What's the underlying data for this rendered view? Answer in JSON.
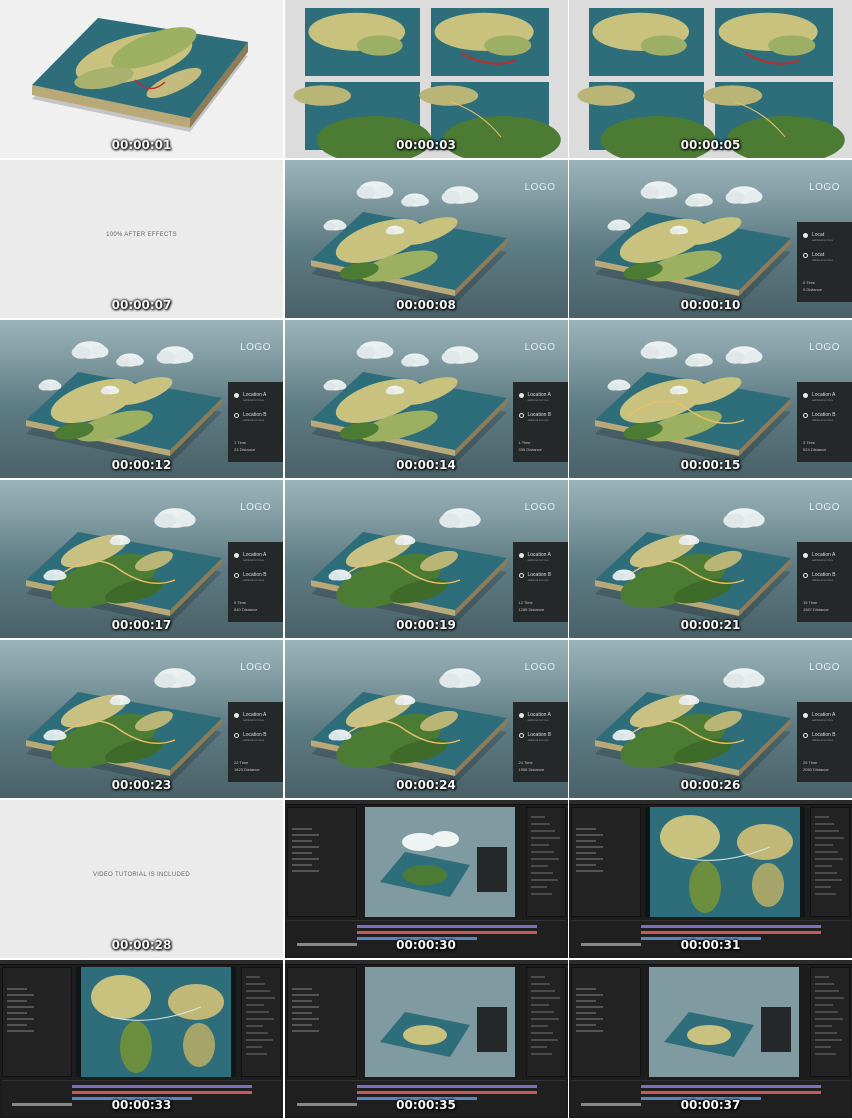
{
  "frames": [
    {
      "time": "00:00:01",
      "kind": "intro-3d"
    },
    {
      "time": "00:00:03",
      "kind": "tiles"
    },
    {
      "time": "00:00:05",
      "kind": "tiles"
    },
    {
      "time": "00:00:07",
      "kind": "plain",
      "caption": "100% AFTER EFFECTS"
    },
    {
      "time": "00:00:08",
      "kind": "map",
      "panel": null
    },
    {
      "time": "00:00:10",
      "kind": "map",
      "panel": {
        "loc_a": "Locat",
        "loc_b": "Locat",
        "time": "Time",
        "distance": "Distance",
        "time_val": "0",
        "distance_val": "0"
      }
    },
    {
      "time": "00:00:12",
      "kind": "map",
      "panel": {
        "loc_a": "Location A",
        "loc_b": "Location B",
        "time": "Time",
        "distance": "Distance",
        "time_val": "1",
        "distance_val": "23"
      }
    },
    {
      "time": "00:00:14",
      "kind": "map",
      "panel": {
        "loc_a": "Location A",
        "loc_b": "Location B",
        "time": "Time",
        "distance": "Distance",
        "time_val": "1",
        "distance_val": "336"
      }
    },
    {
      "time": "00:00:15",
      "kind": "map",
      "panel": {
        "loc_a": "Location A",
        "loc_b": "Location B",
        "time": "Time",
        "distance": "Distance",
        "time_val": "3",
        "distance_val": "524"
      }
    },
    {
      "time": "00:00:17",
      "kind": "map",
      "panel": {
        "loc_a": "Location A",
        "loc_b": "Location B",
        "time": "Time",
        "distance": "Distance",
        "time_val": "9",
        "distance_val": "840"
      }
    },
    {
      "time": "00:00:19",
      "kind": "map",
      "panel": {
        "loc_a": "Location A",
        "loc_b": "Location B",
        "time": "Time",
        "distance": "Distance",
        "time_val": "12",
        "distance_val": "1285"
      }
    },
    {
      "time": "00:00:21",
      "kind": "map",
      "panel": {
        "loc_a": "Location A",
        "loc_b": "Location B",
        "time": "Time",
        "distance": "Distance",
        "time_val": "15",
        "distance_val": "1567"
      }
    },
    {
      "time": "00:00:23",
      "kind": "map",
      "panel": {
        "loc_a": "Location A",
        "loc_b": "Location B",
        "time": "Time",
        "distance": "Distance",
        "time_val": "22",
        "distance_val": "1823"
      }
    },
    {
      "time": "00:00:24",
      "kind": "map",
      "panel": {
        "loc_a": "Location A",
        "loc_b": "Location B",
        "time": "Time",
        "distance": "Distance",
        "time_val": "24",
        "distance_val": "1956"
      }
    },
    {
      "time": "00:00:26",
      "kind": "map",
      "panel": {
        "loc_a": "Location A",
        "loc_b": "Location B",
        "time": "Time",
        "distance": "Distance",
        "time_val": "25",
        "distance_val": "2050"
      }
    },
    {
      "time": "00:00:28",
      "kind": "plain",
      "caption": "VIDEO TUTORIAL IS INCLUDED"
    },
    {
      "time": "00:00:30",
      "kind": "ae"
    },
    {
      "time": "00:00:31",
      "kind": "ae"
    },
    {
      "time": "00:00:33",
      "kind": "ae"
    },
    {
      "time": "00:00:35",
      "kind": "ae"
    },
    {
      "time": "00:00:37",
      "kind": "ae"
    }
  ],
  "panel_subtext": "additional text here",
  "logo": "LOGO",
  "colors": {
    "ocean": "#2d6e7a",
    "land_light": "#c8c27e",
    "land_green": "#4c7c33",
    "bg_scene": "#5e7c84",
    "route": "#e8c06a",
    "route_red": "#c42a2a",
    "panel": "#242829"
  }
}
